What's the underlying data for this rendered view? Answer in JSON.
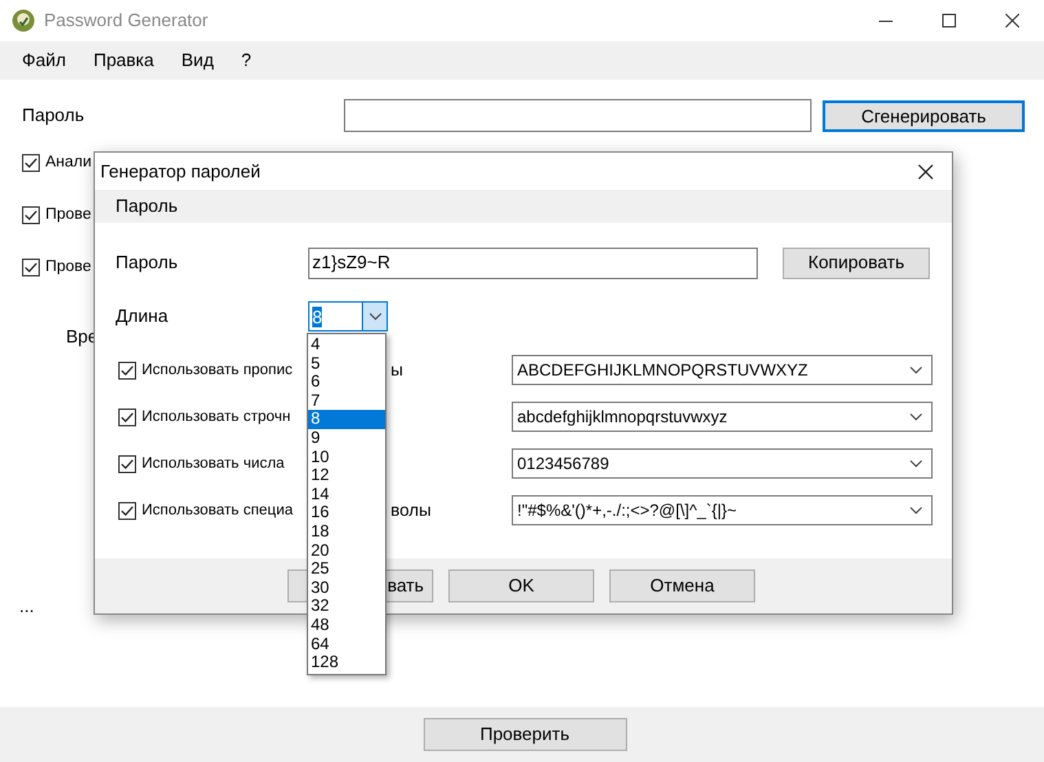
{
  "window": {
    "title": "Password Generator"
  },
  "menu": [
    "Файл",
    "Правка",
    "Вид",
    "?"
  ],
  "main": {
    "password_label": "Пароль",
    "generate_button": "Сгенерировать",
    "options": [
      {
        "label": "Анали",
        "checked": true
      },
      {
        "label": "Прове",
        "checked": true
      },
      {
        "label": "Прове",
        "checked": true
      }
    ],
    "time_label": "Вре",
    "ellipsis": "...",
    "bottom_button": "Проверить"
  },
  "dialog": {
    "title": "Генератор паролей",
    "section": "Пароль",
    "password_label": "Пароль",
    "password_value": "z1}sZ9~R",
    "copy_button": "Копировать",
    "length_label": "Длина",
    "length_value": "8",
    "length_options": [
      {
        "label": "4",
        "selected": false
      },
      {
        "label": "5",
        "selected": false
      },
      {
        "label": "6",
        "selected": false
      },
      {
        "label": "7",
        "selected": false
      },
      {
        "label": "8",
        "selected": true
      },
      {
        "label": "9",
        "selected": false
      },
      {
        "label": "10",
        "selected": false
      },
      {
        "label": "12",
        "selected": false
      },
      {
        "label": "14",
        "selected": false
      },
      {
        "label": "16",
        "selected": false
      },
      {
        "label": "18",
        "selected": false
      },
      {
        "label": "20",
        "selected": false
      },
      {
        "label": "25",
        "selected": false
      },
      {
        "label": "30",
        "selected": false
      },
      {
        "label": "32",
        "selected": false
      },
      {
        "label": "48",
        "selected": false
      },
      {
        "label": "64",
        "selected": false
      },
      {
        "label": "128",
        "selected": false
      }
    ],
    "charsets": [
      {
        "label": "Использовать пропис",
        "tail": "ы",
        "checked": true,
        "value": "ABCDEFGHIJKLMNOPQRSTUVWXYZ"
      },
      {
        "label": "Использовать строчн",
        "checked": true,
        "value": "abcdefghijklmnopqrstuvwxyz"
      },
      {
        "label": "Использовать числа",
        "checked": true,
        "value": "0123456789"
      },
      {
        "label": "Использовать специа",
        "tail": "волы",
        "checked": true,
        "value": "!\"#$%&'()*+,-./:;<>?@[\\]^_`{|}~"
      }
    ],
    "buttons": [
      "вать",
      "OK",
      "Отмена"
    ]
  }
}
